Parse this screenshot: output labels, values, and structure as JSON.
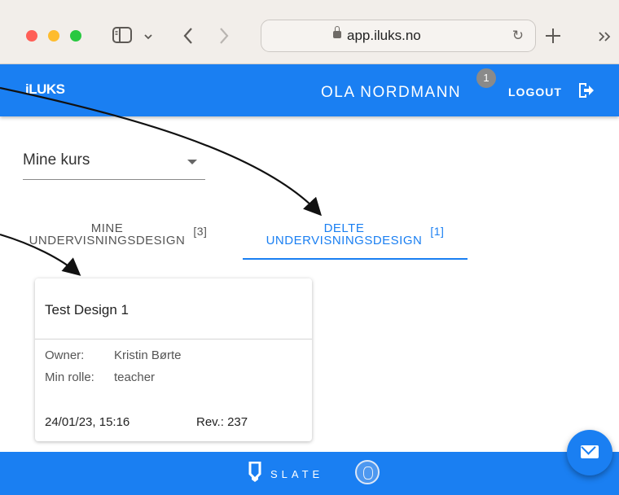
{
  "browser": {
    "url": "app.iluks.no",
    "icons": [
      "sidebar-icon",
      "chevron-down-icon",
      "back-icon",
      "forward-icon",
      "lock-icon",
      "reload-icon",
      "plus-icon",
      "overflow-icon"
    ]
  },
  "header": {
    "logo": "iLUKS",
    "user_name": "OLA NORDMANN",
    "notification_count": "1",
    "logout_label": "LOGOUT"
  },
  "course_select": {
    "value": "Mine kurs"
  },
  "tabs": [
    {
      "label_line1": "MINE",
      "label_line2": "UNDERVISNINGSDESIGN",
      "count": "[3]",
      "active": false
    },
    {
      "label_line1": "DELTE",
      "label_line2": "UNDERVISNINGSDESIGN",
      "count": "[1]",
      "active": true
    }
  ],
  "card": {
    "title": "Test Design 1",
    "owner_label": "Owner:",
    "owner_value": "Kristin Børte",
    "role_label": "Min rolle:",
    "role_value": "teacher",
    "date": "24/01/23, 15:16",
    "revision": "Rev.: 237"
  },
  "footer": {
    "brand": "SLATE"
  },
  "colors": {
    "primary": "#1a7ff2",
    "badge": "#8a8a8a",
    "browser_chrome": "#f2eeea"
  }
}
